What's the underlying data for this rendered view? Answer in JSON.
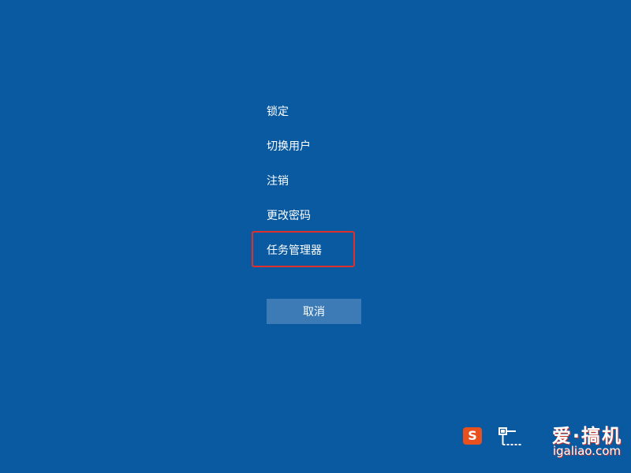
{
  "security_menu": {
    "items": [
      {
        "label": "锁定"
      },
      {
        "label": "切换用户"
      },
      {
        "label": "注销"
      },
      {
        "label": "更改密码"
      },
      {
        "label": "任务管理器"
      }
    ],
    "cancel_label": "取消"
  },
  "tray": {
    "ime_glyph": "S",
    "ime_icon": "sogou-ime-icon",
    "network_icon": "network-icon"
  },
  "watermark": {
    "logo_text": "爱·搞机",
    "url": "igaliao.com"
  },
  "colors": {
    "background": "#0a5aa1",
    "button": "#3d7bb6",
    "highlight": "#e0302b"
  }
}
